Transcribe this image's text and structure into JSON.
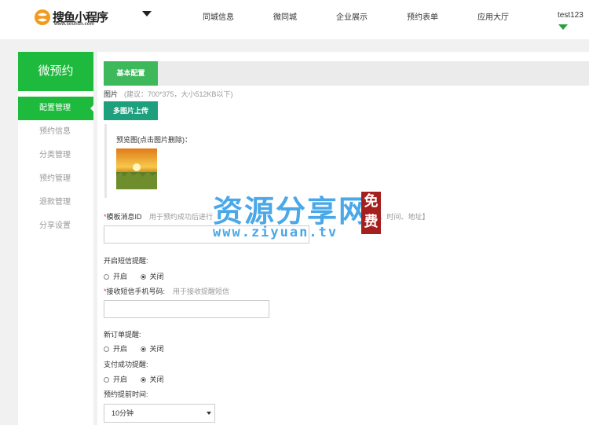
{
  "header": {
    "logo_title": "搜鱼小程序",
    "logo_subtitle": "www.soufish.com",
    "nav": [
      "同城信息",
      "微同城",
      "企业展示",
      "预约表单",
      "应用大厅"
    ],
    "user": "test123"
  },
  "sidebar": {
    "title": "微预约",
    "items": [
      {
        "label": "配置管理",
        "active": true
      },
      {
        "label": "预约信息",
        "active": false
      },
      {
        "label": "分类管理",
        "active": false
      },
      {
        "label": "预约管理",
        "active": false
      },
      {
        "label": "退款管理",
        "active": false
      },
      {
        "label": "分享设置",
        "active": false
      }
    ]
  },
  "main": {
    "tab": "基本配置",
    "image_label": "图片",
    "image_hint": "(建议：700*375，大小512KB以下)",
    "upload_button": "多图片上传",
    "preview_label": "预览图(点击图片删除)：",
    "template_id_label": "模板消息ID",
    "template_id_hint": "用于预约成功后进行",
    "template_id_hint_tail": "】、时间、地址】",
    "template_id_value": "",
    "sms_label": "开启短信提醒:",
    "sms_options": [
      "开启",
      "关闭"
    ],
    "sms_selected": "关闭",
    "phone_label": "接收短信手机号码:",
    "phone_hint": "用于接收提醒短信",
    "phone_value": "",
    "new_order_label": "新订单提醒:",
    "new_order_options": [
      "开启",
      "关闭"
    ],
    "new_order_selected": "关闭",
    "pay_success_label": "支付成功提醒:",
    "pay_success_options": [
      "开启",
      "关闭"
    ],
    "pay_success_selected": "关闭",
    "advance_label": "预约提前时间:",
    "advance_value": "10分钟"
  },
  "watermark": {
    "main": "资源分享网",
    "url": "www.ziyuan.tv",
    "stamp": "免费"
  },
  "colors": {
    "accent_green": "#1eba3d",
    "teal": "#1ea07f",
    "required": "#e23b3b"
  }
}
